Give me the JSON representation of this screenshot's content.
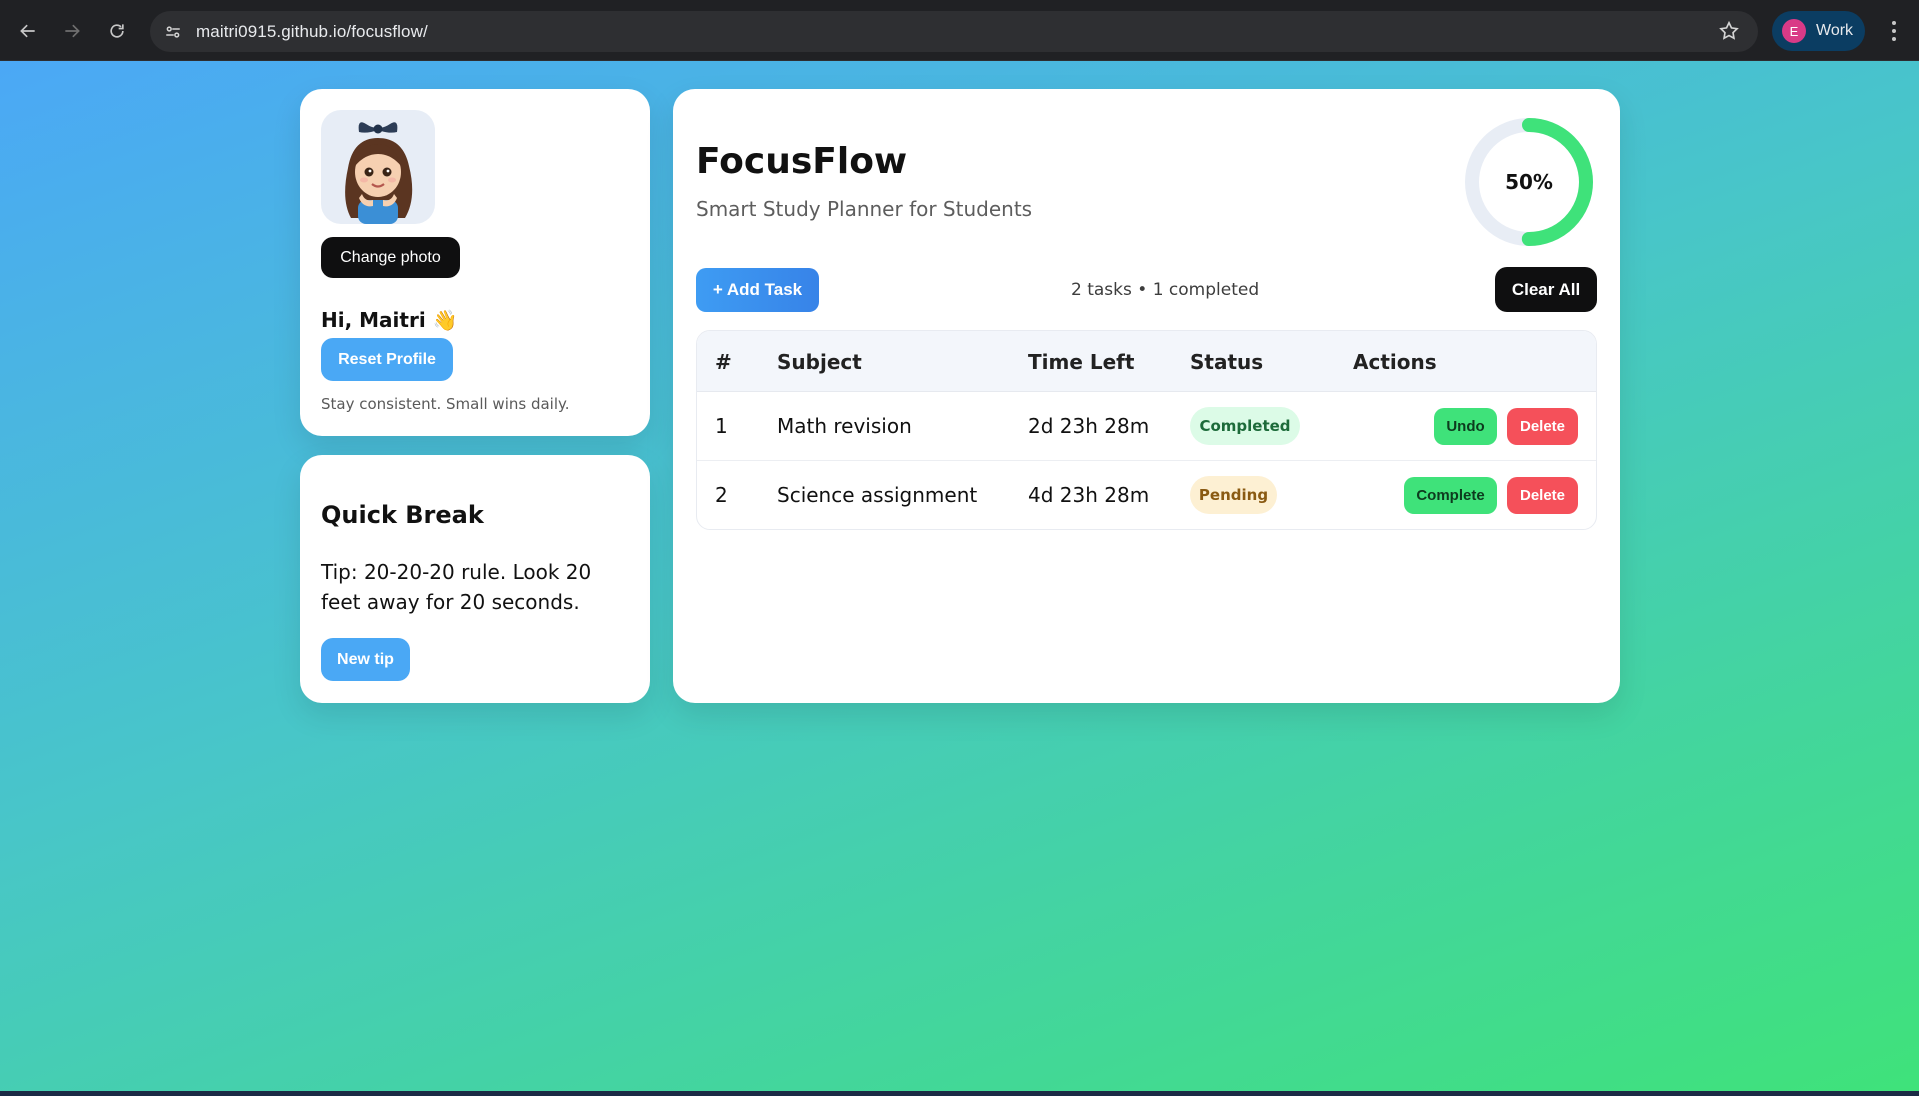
{
  "browser": {
    "url": "maitri0915.github.io/focusflow/",
    "profile_initial": "E",
    "profile_label": "Work"
  },
  "profile": {
    "change_photo_label": "Change photo",
    "greeting": "Hi, Maitri 👋",
    "reset_label": "Reset Profile",
    "motto": "Stay consistent. Small wins daily."
  },
  "quick_break": {
    "title": "Quick Break",
    "tip": "Tip: 20-20-20 rule. Look 20 feet away for 20 seconds.",
    "button_label": "New tip"
  },
  "app": {
    "title": "FocusFlow",
    "subtitle": "Smart Study Planner for Students",
    "progress_percent": 50,
    "progress_label": "50%",
    "add_task_label": "+ Add Task",
    "summary": "2 tasks • 1 completed",
    "clear_all_label": "Clear All"
  },
  "table": {
    "headers": [
      "#",
      "Subject",
      "Time Left",
      "Status",
      "Actions"
    ],
    "rows": [
      {
        "num": "1",
        "subject": "Math revision",
        "time_left": "2d 23h 28m",
        "status": "Completed",
        "action_primary": "Undo",
        "action_delete": "Delete"
      },
      {
        "num": "2",
        "subject": "Science assignment",
        "time_left": "4d 23h 28m",
        "status": "Pending",
        "action_primary": "Complete",
        "action_delete": "Delete"
      }
    ]
  },
  "colors": {
    "accent_blue": "#4aa8f5",
    "success_green": "#3fe27a",
    "danger_red": "#f5505a",
    "dark": "#0f0f10"
  }
}
